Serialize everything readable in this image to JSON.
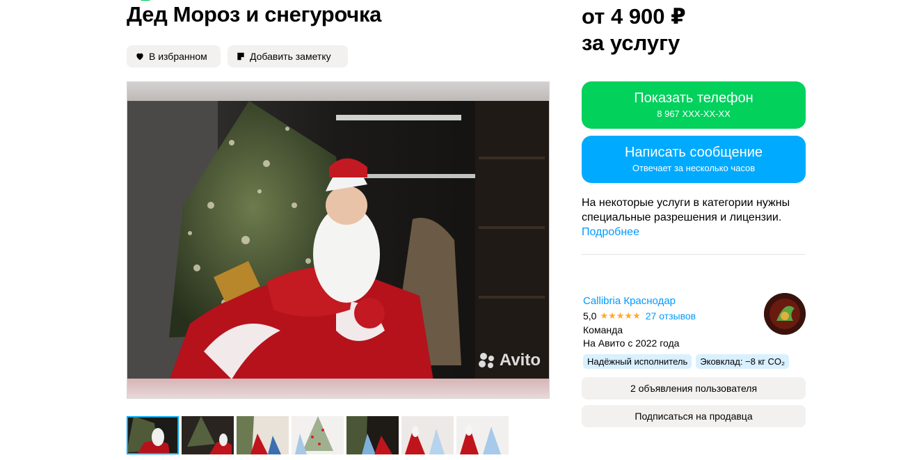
{
  "listing": {
    "title": "Дед Мороз и снегурочка",
    "favorite_label": "В избранном",
    "note_label": "Добавить заметку",
    "watermark": "Avito",
    "thumbnail_count": 7,
    "active_thumbnail": 1
  },
  "price": {
    "line1": "от 4 900 ₽",
    "line2": "за услугу"
  },
  "contact": {
    "phone_label": "Показать телефон",
    "phone_masked": "8 967 XXX-XX-XX",
    "message_label": "Написать сообщение",
    "message_sub": "Отвечает за несколько часов"
  },
  "notice": {
    "text": "На некоторые услуги в категории нужны специальные разрешения и лицензии.",
    "more_link": "Подробнее"
  },
  "seller": {
    "name": "Callibria Краснодар",
    "rating": "5,0",
    "stars": 5,
    "reviews": "27 отзывов",
    "type": "Команда",
    "since": "На Авито с 2022 года",
    "badges": [
      "Надёжный исполнитель",
      "Эковклад: −8 кг CO₂"
    ],
    "ads_button": "2 объявления пользователя",
    "subscribe_button": "Подписаться на продавца"
  },
  "colors": {
    "green": "#02d15c",
    "blue": "#00aaff",
    "link": "#0099ff",
    "star": "#ffa826",
    "chip_bg": "#f2f1f0",
    "badge_bg": "#d9f0ff"
  },
  "icons": {
    "favorite": "heart-icon",
    "note": "note-icon",
    "watermark": "avito-logo-icon"
  }
}
